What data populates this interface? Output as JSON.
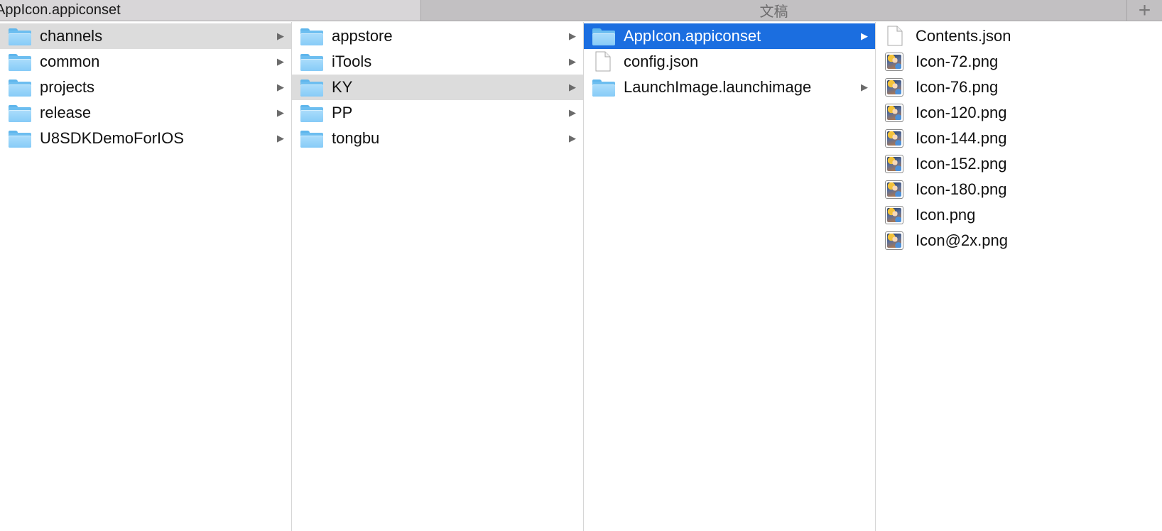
{
  "tabs": {
    "active_label": "AppIcon.appiconset",
    "inactive_label": "文稿",
    "add_label": "+"
  },
  "columns": [
    {
      "items": [
        {
          "label": "channels",
          "icon": "folder-icon",
          "arrow": true,
          "state": "selected-inactive"
        },
        {
          "label": "common",
          "icon": "folder-icon",
          "arrow": true,
          "state": ""
        },
        {
          "label": "projects",
          "icon": "folder-icon",
          "arrow": true,
          "state": ""
        },
        {
          "label": "release",
          "icon": "folder-icon",
          "arrow": true,
          "state": ""
        },
        {
          "label": "U8SDKDemoForIOS",
          "icon": "folder-icon",
          "arrow": true,
          "state": ""
        }
      ]
    },
    {
      "items": [
        {
          "label": "appstore",
          "icon": "folder-icon",
          "arrow": true,
          "state": ""
        },
        {
          "label": "iTools",
          "icon": "folder-icon",
          "arrow": true,
          "state": ""
        },
        {
          "label": "KY",
          "icon": "folder-icon",
          "arrow": true,
          "state": "selected-inactive"
        },
        {
          "label": "PP",
          "icon": "folder-icon",
          "arrow": true,
          "state": ""
        },
        {
          "label": "tongbu",
          "icon": "folder-icon",
          "arrow": true,
          "state": ""
        }
      ]
    },
    {
      "items": [
        {
          "label": "AppIcon.appiconset",
          "icon": "folder-icon",
          "arrow": true,
          "state": "selected-active"
        },
        {
          "label": "config.json",
          "icon": "document-icon",
          "arrow": false,
          "state": ""
        },
        {
          "label": "LaunchImage.launchimage",
          "icon": "folder-icon",
          "arrow": true,
          "state": ""
        }
      ]
    },
    {
      "items": [
        {
          "label": "Contents.json",
          "icon": "document-icon",
          "arrow": false,
          "state": ""
        },
        {
          "label": "Icon-72.png",
          "icon": "image-icon",
          "arrow": false,
          "state": ""
        },
        {
          "label": "Icon-76.png",
          "icon": "image-icon",
          "arrow": false,
          "state": ""
        },
        {
          "label": "Icon-120.png",
          "icon": "image-icon",
          "arrow": false,
          "state": ""
        },
        {
          "label": "Icon-144.png",
          "icon": "image-icon",
          "arrow": false,
          "state": ""
        },
        {
          "label": "Icon-152.png",
          "icon": "image-icon",
          "arrow": false,
          "state": ""
        },
        {
          "label": "Icon-180.png",
          "icon": "image-icon",
          "arrow": false,
          "state": ""
        },
        {
          "label": "Icon.png",
          "icon": "image-icon",
          "arrow": false,
          "state": ""
        },
        {
          "label": "Icon@2x.png",
          "icon": "image-icon",
          "arrow": false,
          "state": ""
        }
      ]
    }
  ],
  "arrow_glyph": "▶",
  "colors": {
    "selection_active": "#1b6ee0",
    "selection_inactive": "#dcdcdc",
    "folder": "#86cbf7"
  }
}
